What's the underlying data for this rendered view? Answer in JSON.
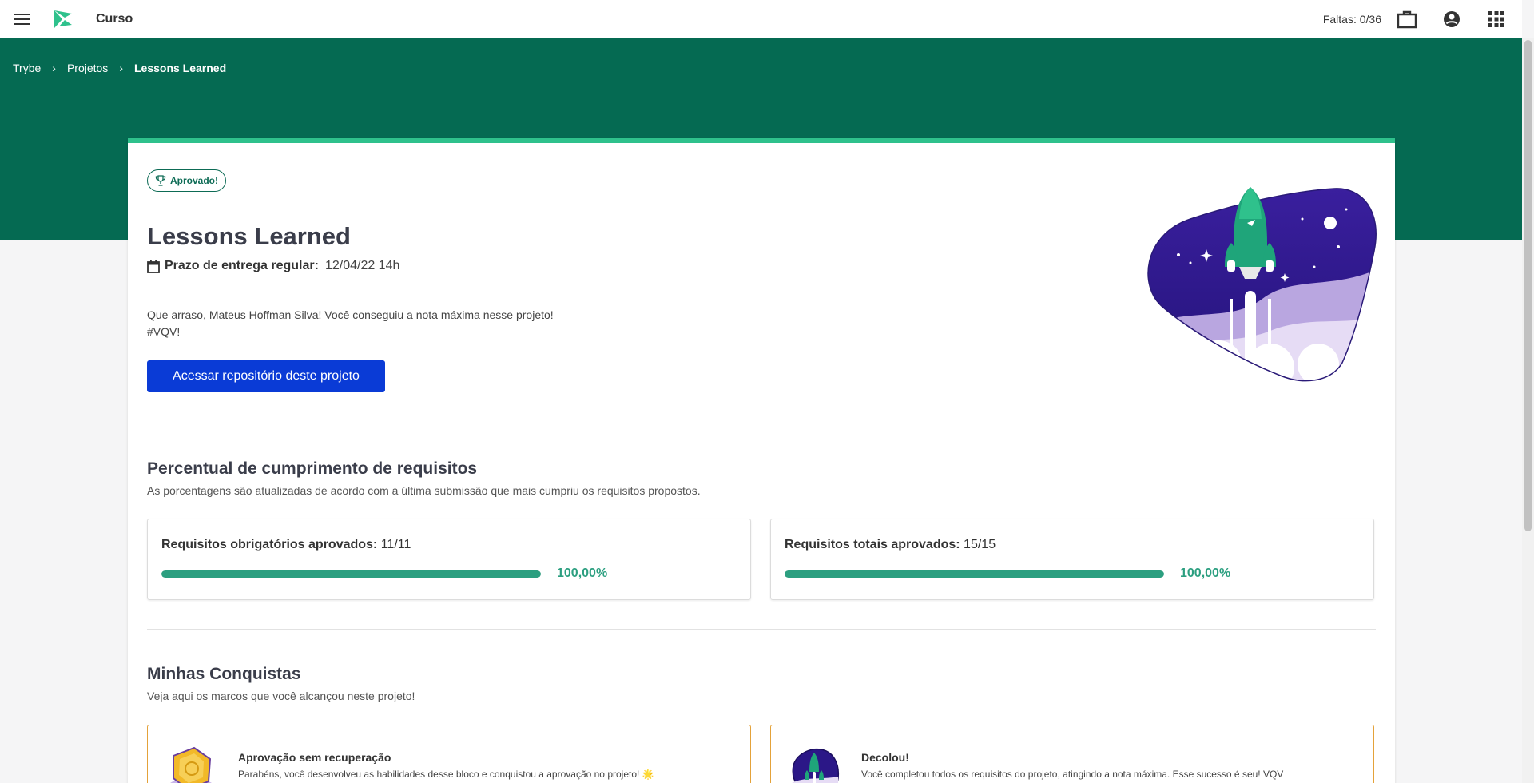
{
  "header": {
    "app_title": "Curso",
    "faltas": "Faltas: 0/36",
    "icons": [
      "menu-icon",
      "trybe-logo",
      "briefcase-icon",
      "account-circle-icon",
      "apps-grid-icon"
    ]
  },
  "breadcrumb": {
    "items": [
      "Trybe",
      "Projetos",
      "Lessons Learned"
    ],
    "separator": "›"
  },
  "project": {
    "badge": "Aprovado!",
    "title": "Lessons Learned",
    "deadline_label": "Prazo de entrega regular:",
    "deadline_value": "12/04/22 14h",
    "message_line1": "Que arraso, Mateus Hoffman Silva! Você conseguiu a nota máxima nesse projeto!",
    "message_line2": "#VQV!",
    "repo_button": "Acessar repositório deste projeto"
  },
  "requirements": {
    "title": "Percentual de cumprimento de requisitos",
    "subtitle": "As porcentagens são atualizadas de acordo com a última submissão que mais cumpriu os requisitos propostos.",
    "items": [
      {
        "label": "Requisitos obrigatórios aprovados:",
        "value": "11/11",
        "percent_text": "100,00%",
        "progress": 1.0
      },
      {
        "label": "Requisitos totais aprovados:",
        "value": "15/15",
        "percent_text": "100,00%",
        "progress": 1.0
      }
    ]
  },
  "achievements": {
    "title": "Minhas Conquistas",
    "subtitle": "Veja aqui os marcos que você alcançou neste projeto!",
    "items": [
      {
        "title": "Aprovação sem recuperação",
        "description": "Parabéns, você desenvolveu as habilidades desse bloco e conquistou a aprovação no projeto! 🌟"
      },
      {
        "title": "Decolou!",
        "description": "Você completou todos os requisitos do projeto, atingindo a nota máxima. Esse sucesso é seu! VQV"
      }
    ]
  },
  "colors": {
    "brand_green": "#056a52",
    "accent_green": "#2fc18c",
    "progress_green": "#2c9f80",
    "button_blue": "#0a3bd6",
    "achievement_border": "#e4a23a"
  }
}
